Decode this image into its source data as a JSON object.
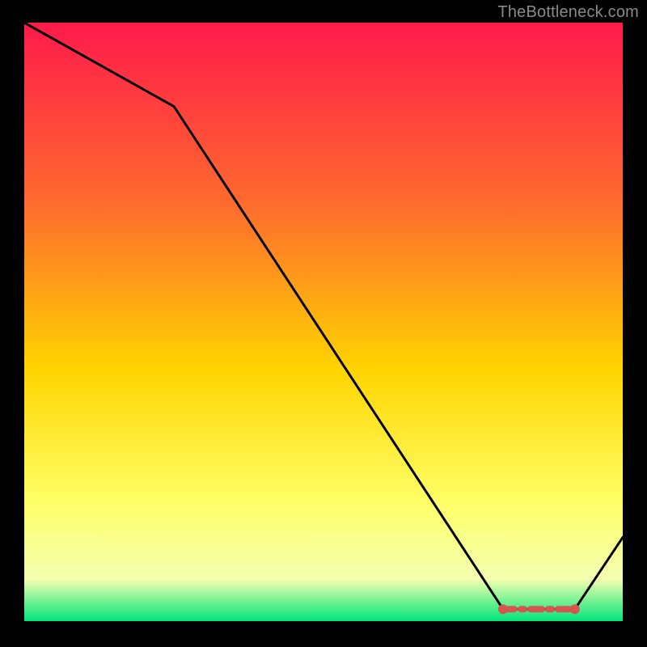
{
  "attribution": "TheBottleneck.com",
  "chart_data": {
    "type": "line",
    "title": "",
    "xlabel": "",
    "ylabel": "",
    "xlim": [
      0,
      100
    ],
    "ylim": [
      0,
      100
    ],
    "x": [
      0,
      25,
      80,
      92,
      100
    ],
    "values": [
      100,
      86,
      2,
      2,
      14
    ],
    "marker_range": {
      "x_start": 80,
      "x_end": 92,
      "y": 2
    }
  },
  "colors": {
    "gradient_top": "#ff1a4b",
    "gradient_mid_upper": "#ff6a2e",
    "gradient_mid": "#ffd400",
    "gradient_mid_lower": "#ffff66",
    "gradient_near_bottom": "#f4ffb0",
    "gradient_bottom": "#00e67a",
    "line": "#000000",
    "marker": "#d9534f",
    "frame": "#000000"
  }
}
